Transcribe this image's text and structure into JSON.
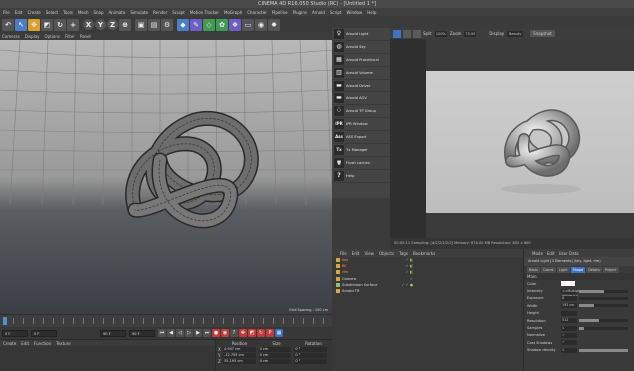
{
  "window": {
    "title": "CINEMA 4D R16.050 Studio (RC) - [Untitled 1 *]"
  },
  "menubar": [
    "File",
    "Edit",
    "Create",
    "Select",
    "Tools",
    "Mesh",
    "Snap",
    "Animate",
    "Simulate",
    "Render",
    "Sculpt",
    "Motion Tracker",
    "MoGraph",
    "Character",
    "Pipeline",
    "Plugins",
    "Arnold",
    "Script",
    "Window",
    "Help"
  ],
  "toolbar": [
    {
      "icon": "undo-icon",
      "glyph": "↶",
      "color": "#555"
    },
    {
      "icon": "live-selection-icon",
      "glyph": "↖",
      "color": "#4a7ec8"
    },
    {
      "icon": "move-icon",
      "glyph": "✥",
      "color": "#d7a12c"
    },
    {
      "icon": "scale-icon",
      "glyph": "◩",
      "color": "#555"
    },
    {
      "icon": "rotate-icon",
      "glyph": "↻",
      "color": "#555"
    },
    {
      "icon": "recent-tool-icon",
      "glyph": "+",
      "color": "#555"
    },
    {
      "icon": "x-axis-icon",
      "glyph": "X",
      "color": "#555",
      "round": true
    },
    {
      "icon": "y-axis-icon",
      "glyph": "Y",
      "color": "#555",
      "round": true
    },
    {
      "icon": "z-axis-icon",
      "glyph": "Z",
      "color": "#555",
      "round": true
    },
    {
      "icon": "coordinate-system-icon",
      "glyph": "⊕",
      "color": "#555"
    },
    {
      "icon": "render-view-icon",
      "glyph": "▣",
      "color": "#555"
    },
    {
      "icon": "render-picture-viewer-icon",
      "glyph": "▤",
      "color": "#555"
    },
    {
      "icon": "render-settings-icon",
      "glyph": "⚙",
      "color": "#555"
    },
    {
      "icon": "cube-icon",
      "glyph": "◆",
      "color": "#4a7ec8"
    },
    {
      "icon": "spline-pen-icon",
      "glyph": "✎",
      "color": "#6c5ec4"
    },
    {
      "icon": "subdivision-icon",
      "glyph": "◇",
      "color": "#3f9a52"
    },
    {
      "icon": "array-icon",
      "glyph": "✿",
      "color": "#3f9a52"
    },
    {
      "icon": "deformer-icon",
      "glyph": "❖",
      "color": "#6c5ec4"
    },
    {
      "icon": "floor-icon",
      "glyph": "▭",
      "color": "#555"
    },
    {
      "icon": "camera-icon",
      "glyph": "◉",
      "color": "#555"
    },
    {
      "icon": "light-icon",
      "glyph": "✸",
      "color": "#555"
    }
  ],
  "viewport": {
    "menu": [
      "Cameras",
      "Display",
      "Options",
      "Filter",
      "Panel"
    ],
    "grid_spacing": "Grid Spacing : 100 cm"
  },
  "timeline": {
    "start_frame": "0 F",
    "current_frame": "0 F",
    "end_frame": "90 F",
    "max_frame": "90 F"
  },
  "material_panel": {
    "menu": [
      "Create",
      "Edit",
      "Function",
      "Texture"
    ]
  },
  "coordinates": {
    "headers": [
      "Position",
      "Size",
      "Rotation"
    ],
    "rows": [
      {
        "axis": "X",
        "pos": "4.947 cm",
        "size": "0 cm",
        "rot": "0 °"
      },
      {
        "axis": "Y",
        "pos": "-12.755 cm",
        "size": "0 cm",
        "rot": "0 °"
      },
      {
        "axis": "Z",
        "pos": "35.193 cm",
        "size": "0 cm",
        "rot": "0 °"
      }
    ]
  },
  "arnold_menu": [
    {
      "icon": "arnold-light-icon",
      "glyph": "♀",
      "label": "Arnold Light"
    },
    {
      "icon": "arnold-sky-icon",
      "glyph": "◍",
      "label": "Arnold Sky"
    },
    {
      "icon": "arnold-procedural-icon",
      "glyph": "▦",
      "label": "Arnold Procedural"
    },
    {
      "icon": "arnold-volume-icon",
      "glyph": "▥",
      "label": "Arnold Volume"
    },
    {
      "icon": "arnold-driver-icon",
      "glyph": "▬",
      "label": "Arnold Driver"
    },
    {
      "icon": "arnold-aov-icon",
      "glyph": "▬",
      "label": "Arnold AOV"
    },
    {
      "icon": "arnold-tp-group-icon",
      "glyph": "⁘",
      "label": "Arnold TP Group"
    },
    {
      "icon": "ipr-window-icon",
      "glyph": "IPR",
      "label": "IPR Window"
    },
    {
      "icon": "ass-export-icon",
      "glyph": "Ass",
      "label": "ASS Export"
    },
    {
      "icon": "tx-manager-icon",
      "glyph": "Tx",
      "label": "Tx Manager"
    },
    {
      "icon": "flush-caches-icon",
      "glyph": "🗑",
      "label": "Flush caches"
    },
    {
      "icon": "help-icon",
      "glyph": "?",
      "label": "Help"
    }
  ],
  "ipr": {
    "split_label": "Split",
    "split_value": "100%",
    "zoom_label": "Zoom",
    "zoom_value": "75.00",
    "display_label": "Display",
    "display_value": "Beauty",
    "snapshot_label": "Snapshot"
  },
  "render_status": "00:00:11  Sampling: [4/2/2/2/2/2]  Memory: 876.00 MB  Resolution: 800 x 600",
  "object_manager": {
    "menu": [
      "File",
      "Edit",
      "View",
      "Objects",
      "Tags",
      "Bookmarks"
    ],
    "objects": [
      {
        "name": "key",
        "type": "light",
        "tags": "✓ ◧",
        "highlight": true
      },
      {
        "name": "fill",
        "type": "light",
        "tags": "✓ ◧",
        "highlight": true
      },
      {
        "name": "rim",
        "type": "light",
        "tags": "✓ ◧",
        "highlight": true
      },
      {
        "name": "Camera",
        "type": "camera",
        "tags": "✓",
        "highlight": false
      },
      {
        "name": "Subdivision Surface",
        "type": "generator",
        "tags": "✓ ✓ ●",
        "highlight": false
      },
      {
        "name": "Arnold TR",
        "type": "object",
        "tags": "",
        "highlight": false
      }
    ]
  },
  "attribute_manager": {
    "menu": [
      "Mode",
      "Edit",
      "User Data"
    ],
    "title": "Arnold Light [3 Elements] (key, light, rim)",
    "tabs": [
      {
        "label": "Basic",
        "active": false
      },
      {
        "label": "Coord.",
        "active": false
      },
      {
        "label": "Light",
        "active": false
      },
      {
        "label": "Shape",
        "active": true
      },
      {
        "label": "Details",
        "active": false
      },
      {
        "label": "Project",
        "active": false
      }
    ],
    "section": "Main",
    "rows": [
      {
        "label": "Color",
        "value": "",
        "slider": null,
        "is_color": true
      },
      {
        "label": "Intensity",
        "value": "<<Multiple Values>>",
        "slider": 0.5
      },
      {
        "label": "Exposure",
        "value": "0",
        "slider": 0.0
      },
      {
        "label": "Width",
        "value": "192 cm",
        "slider": 0.3
      },
      {
        "label": "Height",
        "value": "",
        "slider": null
      },
      {
        "label": "Resolution",
        "value": "512",
        "slider": 0.4
      },
      {
        "label": "Samples",
        "value": "1",
        "slider": 0.1
      },
      {
        "label": "Normalize",
        "value": "✓",
        "slider": null
      },
      {
        "label": "Cast Shadows",
        "value": "✓",
        "slider": null
      },
      {
        "label": "Shadow density",
        "value": "1",
        "slider": 1.0
      }
    ]
  }
}
